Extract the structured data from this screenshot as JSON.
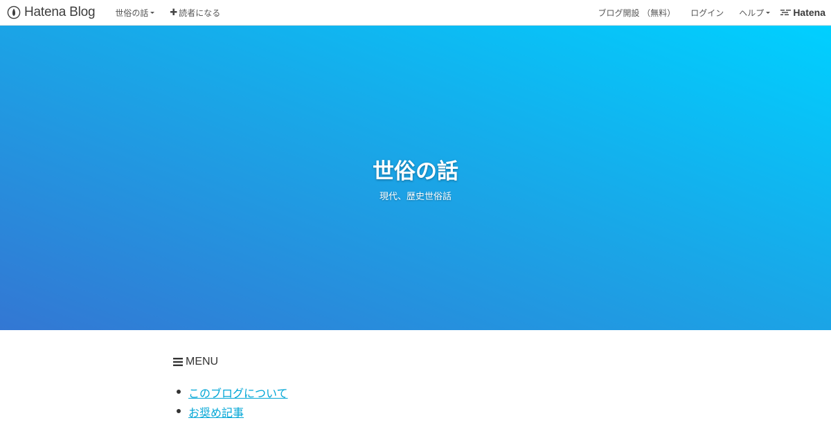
{
  "topbar": {
    "logo_text": "Hatena Blog",
    "blog_menu_label": "世俗の話",
    "subscribe_label": "読者になる",
    "start_blog_label": "ブログ開設 （無料）",
    "login_label": "ログイン",
    "help_label": "ヘルプ",
    "brand_label": "Hatena"
  },
  "hero": {
    "title": "世俗の話",
    "description": "現代、歴史世俗話",
    "gradient_colors": [
      "#3377d3",
      "#1ba4e6",
      "#00d0ff"
    ]
  },
  "menu": {
    "heading": "MENU",
    "items": [
      {
        "label": "このブログについて"
      },
      {
        "label": "お奨め記事"
      }
    ]
  },
  "colors": {
    "link": "#00a6d6",
    "text": "#333333"
  }
}
